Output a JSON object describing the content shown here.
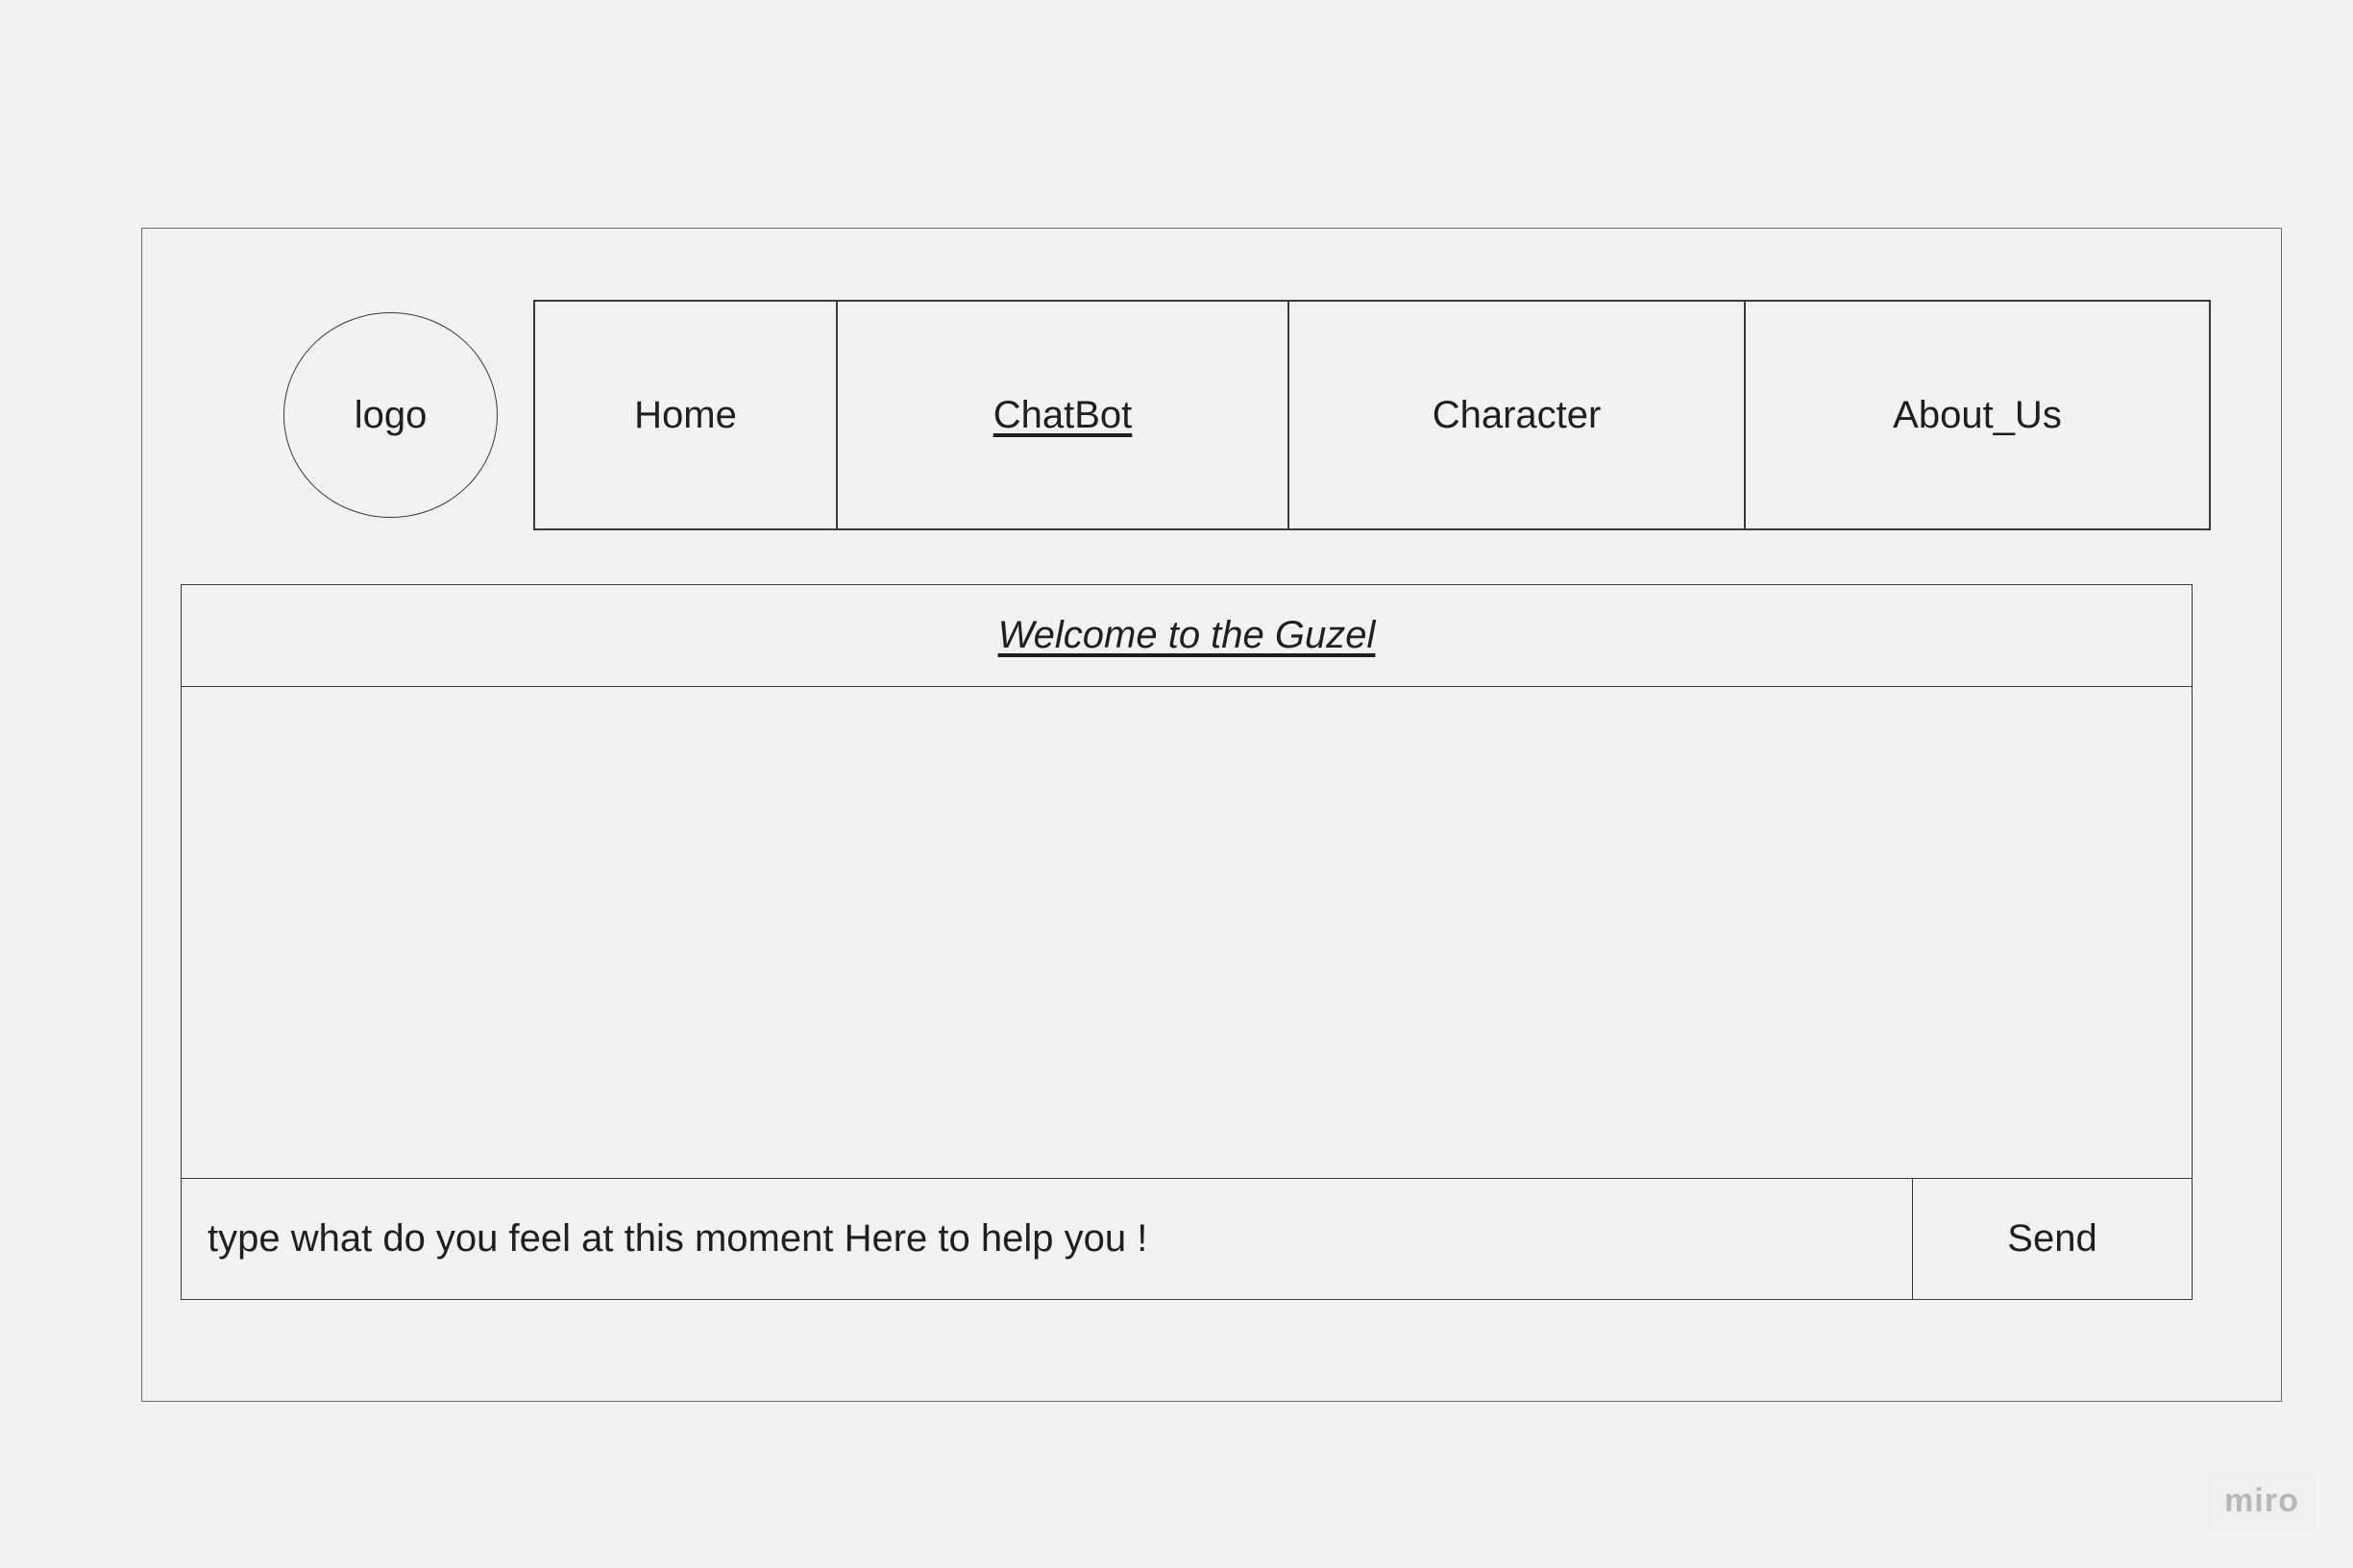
{
  "logo": {
    "label": "logo"
  },
  "nav": {
    "items": [
      {
        "label": "Home"
      },
      {
        "label": "ChatBot",
        "active": true
      },
      {
        "label": "Character"
      },
      {
        "label": "About_Us"
      }
    ]
  },
  "chat": {
    "title": "Welcome to the Guzel",
    "input": {
      "value": "",
      "placeholder": "type what do you feel at this moment Here to help you !"
    },
    "send_label": "Send"
  },
  "watermark": {
    "text": "miro"
  },
  "colors": {
    "background": "#f2f2f2",
    "border": "#3a3a3a",
    "text": "#1f1f1f",
    "watermark": "#b7b7b7"
  }
}
